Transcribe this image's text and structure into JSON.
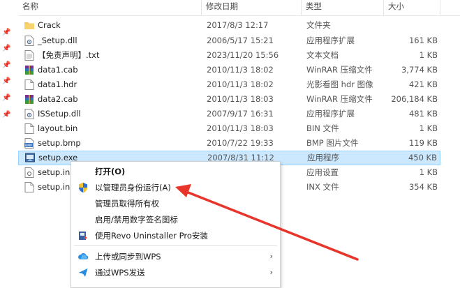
{
  "header": {
    "name": "名称",
    "date": "修改日期",
    "type": "类型",
    "size": "大小"
  },
  "files": [
    {
      "name": "Crack",
      "date": "2017/8/3 12:17",
      "type": "文件夹",
      "size": "",
      "icon": "folder-icon"
    },
    {
      "name": "_Setup.dll",
      "date": "2006/5/17 15:21",
      "type": "应用程序扩展",
      "size": "161 KB",
      "icon": "dll-file-icon"
    },
    {
      "name": "【免责声明】.txt",
      "date": "2023/11/20 15:56",
      "type": "文本文档",
      "size": "1 KB",
      "icon": "text-file-icon"
    },
    {
      "name": "data1.cab",
      "date": "2010/11/3 18:02",
      "type": "WinRAR 压缩文件",
      "size": "3,774 KB",
      "icon": "winrar-archive-icon"
    },
    {
      "name": "data1.hdr",
      "date": "2010/11/3 18:02",
      "type": "光影看图 hdr 图像",
      "size": "421 KB",
      "icon": "generic-file-icon"
    },
    {
      "name": "data2.cab",
      "date": "2010/11/3 18:03",
      "type": "WinRAR 压缩文件",
      "size": "206,184 KB",
      "icon": "winrar-archive-icon"
    },
    {
      "name": "ISSetup.dll",
      "date": "2007/9/17 16:31",
      "type": "应用程序扩展",
      "size": "481 KB",
      "icon": "dll-file-icon"
    },
    {
      "name": "layout.bin",
      "date": "2010/11/3 18:03",
      "type": "BIN 文件",
      "size": "1 KB",
      "icon": "generic-file-icon"
    },
    {
      "name": "setup.bmp",
      "date": "2010/7/22 19:33",
      "type": "BMP 图片文件",
      "size": "119 KB",
      "icon": "bmp-file-icon"
    },
    {
      "name": "setup.exe",
      "date": "2007/8/31 11:12",
      "type": "应用程序",
      "size": "450 KB",
      "icon": "setup-exe-icon"
    },
    {
      "name": "setup.ini",
      "date": "",
      "type": "应用设置",
      "size": "1 KB",
      "icon": "settings-file-icon"
    },
    {
      "name": "setup.inx",
      "date": "",
      "type": "INX 文件",
      "size": "354 KB",
      "icon": "generic-file-icon"
    }
  ],
  "visible_names": {
    "setup_ini": "setup.in",
    "setup_inx": "setup.in"
  },
  "context_menu": {
    "open": "打开(O)",
    "run_as_admin": "以管理员身份运行(A)",
    "take_ownership": "管理员取得所有权",
    "toggle_signature": "启用/禁用数字签名图标",
    "revo_uninstall": "使用Revo Uninstaller Pro安装",
    "wps_upload": "上传或同步到WPS",
    "wps_send": "通过WPS发送"
  },
  "colors": {
    "selection_bg": "#cce8ff",
    "selection_border": "#99d1ff",
    "annotation_arrow": "#e8352b",
    "folder": "#f3c55a"
  }
}
